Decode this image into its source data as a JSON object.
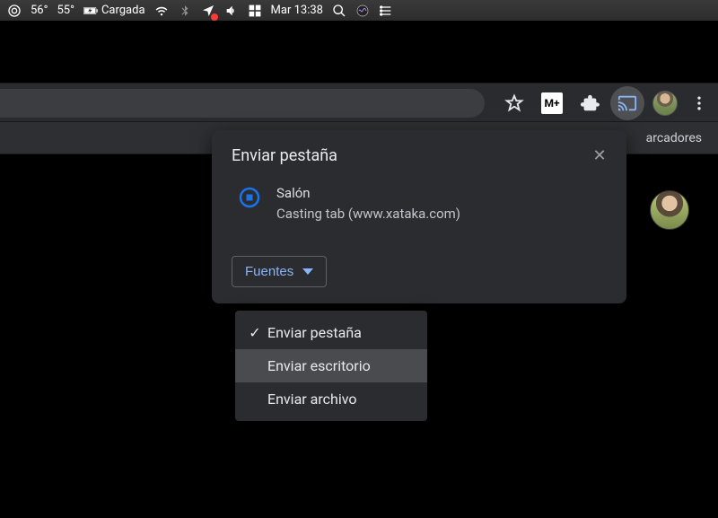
{
  "menubar": {
    "temp1": "56°",
    "temp2": "55°",
    "battery_label": "Cargada",
    "clock": "Mar 13:38"
  },
  "browser": {
    "bookmarks_visible_text": "arcadores",
    "mplus_label": "M+"
  },
  "cast": {
    "title": "Enviar pestaña",
    "device_name": "Salón",
    "device_status": "Casting tab (www.xataka.com)",
    "sources_label": "Fuentes"
  },
  "sources_menu": {
    "items": [
      {
        "label": "Enviar pestaña",
        "checked": true,
        "hover": false
      },
      {
        "label": "Enviar escritorio",
        "checked": false,
        "hover": true
      },
      {
        "label": "Enviar archivo",
        "checked": false,
        "hover": false
      }
    ]
  }
}
